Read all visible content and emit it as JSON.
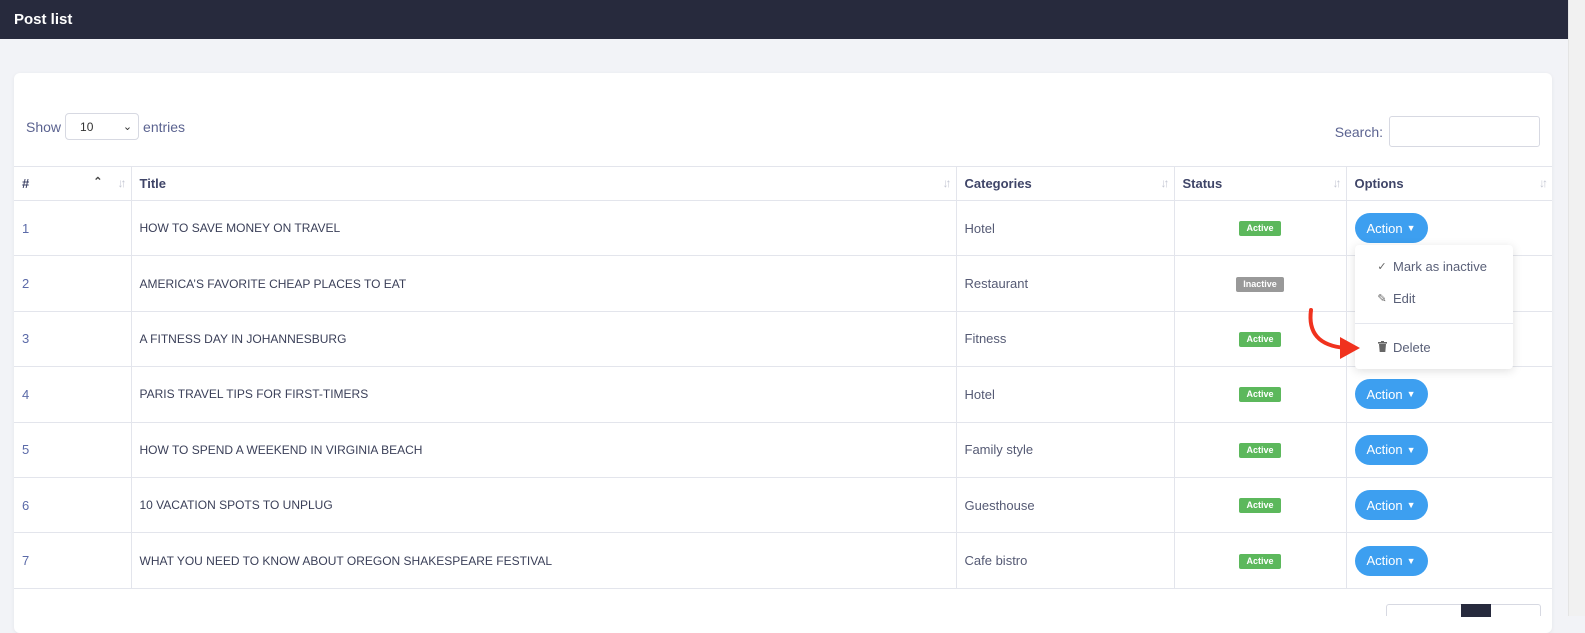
{
  "header": {
    "title": "Post list"
  },
  "length": {
    "show_label": "Show",
    "value": "10",
    "entries_label": "entries"
  },
  "search": {
    "label": "Search:",
    "value": ""
  },
  "columns": [
    "#",
    "Title",
    "Categories",
    "Status",
    "Options"
  ],
  "rows": [
    {
      "num": "1",
      "title": "HOW TO SAVE MONEY ON TRAVEL",
      "category": "Hotel",
      "status": "Active"
    },
    {
      "num": "2",
      "title": "AMERICA’S FAVORITE CHEAP PLACES TO EAT",
      "category": "Restaurant",
      "status": "Inactive"
    },
    {
      "num": "3",
      "title": "A FITNESS DAY IN JOHANNESBURG",
      "category": "Fitness",
      "status": "Active"
    },
    {
      "num": "4",
      "title": "PARIS TRAVEL TIPS FOR FIRST-TIMERS",
      "category": "Hotel",
      "status": "Active"
    },
    {
      "num": "5",
      "title": "HOW TO SPEND A WEEKEND IN VIRGINIA BEACH",
      "category": "Family style",
      "status": "Active"
    },
    {
      "num": "6",
      "title": "10 VACATION SPOTS TO UNPLUG",
      "category": "Guesthouse",
      "status": "Active"
    },
    {
      "num": "7",
      "title": "WHAT YOU NEED TO KNOW ABOUT OREGON SHAKESPEARE FESTIVAL",
      "category": "Cafe bistro",
      "status": "Active"
    }
  ],
  "action_label": "Action",
  "dropdown": {
    "mark_inactive": "Mark as inactive",
    "edit": "Edit",
    "delete": "Delete"
  },
  "colors": {
    "topbar": "#272a3d",
    "active": "#5cb85c",
    "inactive": "#999999",
    "action": "#3d9ff0",
    "arrow": "#f0321e"
  },
  "icons": {
    "check": "check-icon",
    "edit": "pencil-icon",
    "delete": "trash-icon"
  }
}
